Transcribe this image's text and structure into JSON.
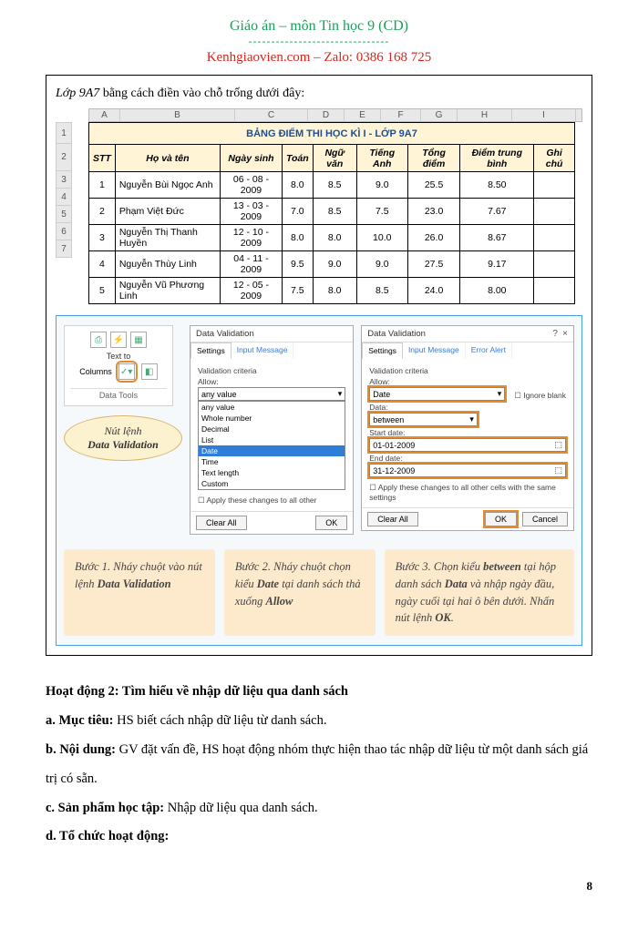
{
  "header": {
    "title": "Giáo án – môn Tin học 9 (CD)",
    "sep": "-------------------------------",
    "subtitle": "Kenhgiaovien.com – Zalo: 0386 168 725"
  },
  "intro": {
    "prefix_italic": "Lớp 9A7",
    "rest": " bằng cách điền vào chỗ trống dưới đây:"
  },
  "sheet": {
    "col_letters": [
      "A",
      "B",
      "C",
      "D",
      "E",
      "F",
      "G",
      "H",
      "I"
    ],
    "row_nums": [
      "1",
      "2",
      "3",
      "4",
      "5",
      "6",
      "7"
    ],
    "title": "BẢNG ĐIỂM THI HỌC KÌ I - LỚP 9A7",
    "headers": [
      "STT",
      "Họ và tên",
      "Ngày sinh",
      "Toán",
      "Ngữ văn",
      "Tiếng Anh",
      "Tổng điểm",
      "Điểm trung bình",
      "Ghi chú"
    ],
    "rows": [
      {
        "stt": "1",
        "name": "Nguyễn Bùi Ngọc Anh",
        "dob": "06 - 08 - 2009",
        "toan": "8.0",
        "van": "8.5",
        "anh": "9.0",
        "tong": "25.5",
        "tb": "8.50",
        "ghi": ""
      },
      {
        "stt": "2",
        "name": "Phạm Việt Đức",
        "dob": "13 - 03 - 2009",
        "toan": "7.0",
        "van": "8.5",
        "anh": "7.5",
        "tong": "23.0",
        "tb": "7.67",
        "ghi": ""
      },
      {
        "stt": "3",
        "name": "Nguyễn Thị Thanh Huyền",
        "dob": "12 - 10 - 2009",
        "toan": "8.0",
        "van": "8.0",
        "anh": "10.0",
        "tong": "26.0",
        "tb": "8.67",
        "ghi": ""
      },
      {
        "stt": "4",
        "name": "Nguyễn Thùy Linh",
        "dob": "04 - 11 - 2009",
        "toan": "9.5",
        "van": "9.0",
        "anh": "9.0",
        "tong": "27.5",
        "tb": "9.17",
        "ghi": ""
      },
      {
        "stt": "5",
        "name": "Nguyễn Vũ Phương Linh",
        "dob": "12 - 05 - 2009",
        "toan": "7.5",
        "van": "8.0",
        "anh": "8.5",
        "tong": "24.0",
        "tb": "8.00",
        "ghi": ""
      }
    ]
  },
  "ribbon": {
    "text_to": "Text to",
    "columns": "Columns",
    "data_tools": "Data Tools"
  },
  "callout": {
    "line1": "Nút lệnh",
    "line2": "Data Validation"
  },
  "dialog1": {
    "title": "Data Validation",
    "tab_settings": "Settings",
    "tab_input": "Input Message",
    "criteria": "Validation criteria",
    "allow": "Allow:",
    "allow_value": "any value",
    "opts": [
      "any value",
      "Whole number",
      "Decimal",
      "List",
      "Date",
      "Time",
      "Text length",
      "Custom"
    ],
    "highlight_idx": 4,
    "apply": "Apply these changes to all other",
    "clear": "Clear All",
    "ok": "OK"
  },
  "dialog2": {
    "title": "Data Validation",
    "tab_settings": "Settings",
    "tab_input": "Input Message",
    "tab_error": "Error Alert",
    "criteria": "Validation criteria",
    "allow": "Allow:",
    "allow_value": "Date",
    "ignore": "Ignore blank",
    "data_lbl": "Data:",
    "data_value": "between",
    "start_lbl": "Start date:",
    "start_value": "01-01-2009",
    "end_lbl": "End date:",
    "end_value": "31-12-2009",
    "apply": "Apply these changes to all other cells with the same settings",
    "clear": "Clear All",
    "ok": "OK",
    "cancel": "Cancel",
    "close": "×",
    "q": "?"
  },
  "steps": {
    "s1": {
      "pre": "Bước 1. Nháy chuột vào nút lệnh ",
      "b": "Data Validation"
    },
    "s2": {
      "pre": "Bước 2. Nháy chuột chọn kiểu ",
      "b1": "Date",
      "mid": " tại danh sách thả xuống ",
      "b2": "Allow"
    },
    "s3": {
      "pre": "Bước 3. Chọn kiểu ",
      "b1": "between",
      "mid1": " tại hộp danh sách ",
      "b2": "Data",
      "mid2": " và nhập ngày đầu, ngày cuối tại hai ô bên dưới. Nhấn nút lệnh ",
      "b3": "OK",
      "end": "."
    }
  },
  "body": {
    "h": "Hoạt động 2: Tìm hiểu về nhập dữ liệu qua danh sách",
    "a_lbl": "a. Mục tiêu: ",
    "a_txt": "HS biết cách nhập dữ liệu từ danh sách.",
    "b_lbl": "b. Nội dung: ",
    "b_txt": "GV đặt vấn đề, HS hoạt động nhóm thực hiện thao tác nhập dữ liệu từ một danh sách giá trị có sẵn.",
    "c_lbl": "c. Sản phẩm học tập: ",
    "c_txt": "Nhập dữ liệu qua danh sách.",
    "d_lbl": "d. Tổ chức hoạt động:"
  },
  "pagenum": "8"
}
